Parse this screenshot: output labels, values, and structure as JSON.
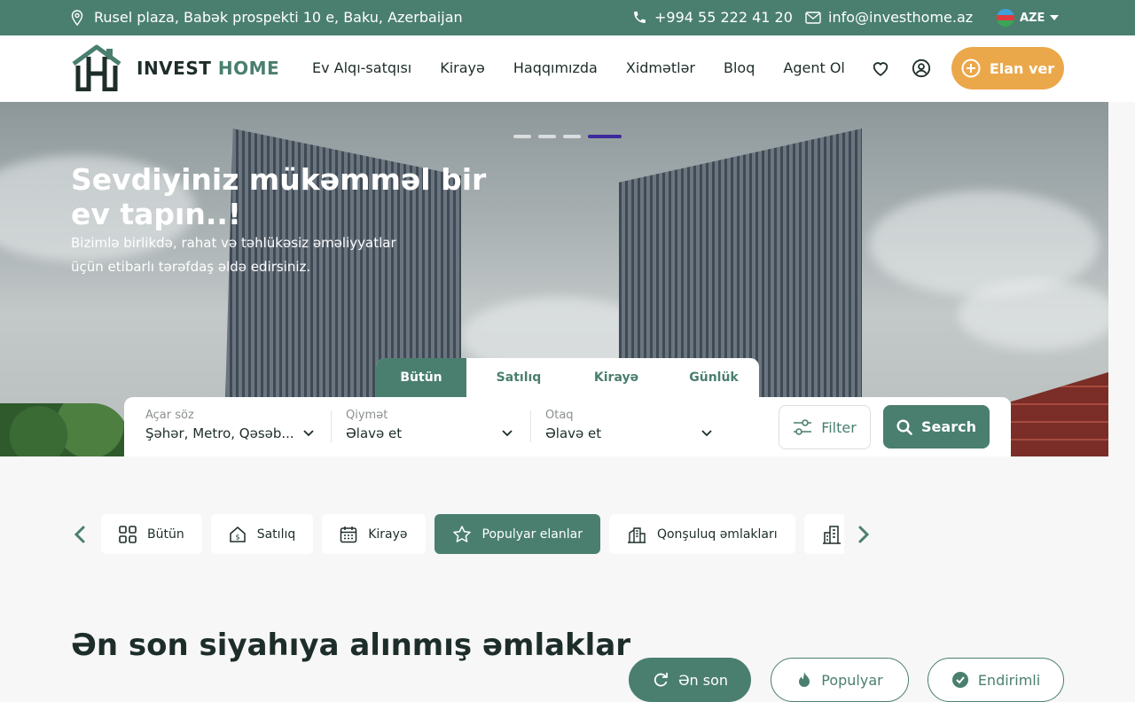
{
  "topbar": {
    "address": "Rusel plaza, Babək prospekti 10 e, Baku, Azerbaijan",
    "phone": "+994 55 222 41 20",
    "email": "info@investhome.az",
    "language": "AZE"
  },
  "header": {
    "logo_part1": "INVEST",
    "logo_part2": "HOME",
    "nav": [
      "Ev Alqı-satqısı",
      "Kirayə",
      "Haqqımızda",
      "Xidmətlər",
      "Bloq",
      "Agent Ol"
    ],
    "cta_label": "Elan ver"
  },
  "hero": {
    "title": "Sevdiyiniz mükəmməl bir ev tapın..!",
    "subtitle": "Bizimlə birlikdə, rahat və təhlükəsiz əməliyyatlar üçün etibarlı tərəfdaş əldə edirsiniz.",
    "slides_total": 4,
    "active_slide": 4
  },
  "search": {
    "tabs": [
      "Bütün",
      "Satılıq",
      "Kirayə",
      "Günlük"
    ],
    "active_tab": "Bütün",
    "keyword_label": "Açar söz",
    "keyword_value": "Şəhər, Metro, Qəsəb...",
    "price_label": "Qiymət",
    "price_value": "Əlavə et",
    "rooms_label": "Otaq",
    "rooms_value": "Əlavə et",
    "filter_label": "Filter",
    "search_label": "Search"
  },
  "categories": {
    "items": [
      {
        "label": "Bütün",
        "icon": "grid-icon"
      },
      {
        "label": "Satılıq",
        "icon": "house-dollar-icon"
      },
      {
        "label": "Kirayə",
        "icon": "calendar-icon"
      },
      {
        "label": "Populyar elanlar",
        "icon": "star-icon"
      },
      {
        "label": "Qonşuluq əmlakları",
        "icon": "buildings-icon"
      }
    ],
    "active": "Populyar elanlar"
  },
  "listings": {
    "title": "Ən son siyahıya alınmış əmlaklar",
    "filters": [
      "Ən son",
      "Populyar",
      "Endirimli"
    ]
  },
  "colors": {
    "brand_green": "#4a7f70",
    "accent_orange": "#eba84b",
    "active_dot": "#3d2a9c"
  }
}
